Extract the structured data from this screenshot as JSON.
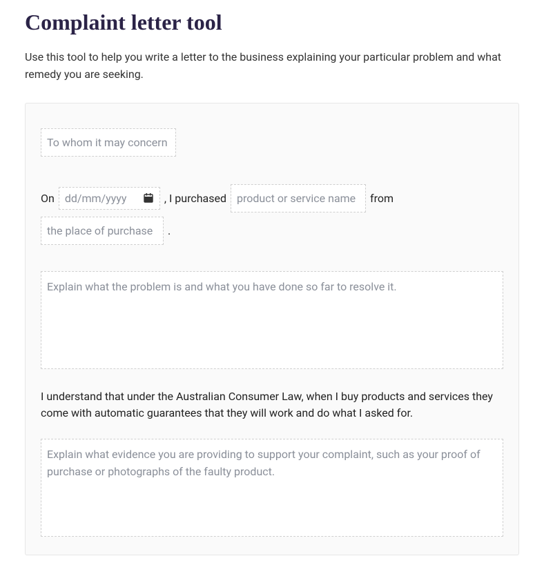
{
  "title": "Complaint letter tool",
  "intro": "Use this tool to help you write a letter to the business explaining your particular problem and what remedy you are seeking.",
  "form": {
    "salutation_placeholder": "To whom it may concern",
    "sentence": {
      "on": "On",
      "date_placeholder": "dd/mm/yyyy",
      "i_purchased": ", I purchased",
      "product_placeholder": "product or service name",
      "from": "from",
      "place_placeholder": "the place of purchase",
      "period": "."
    },
    "problem_placeholder": "Explain what the problem is and what you have done so far to resolve it.",
    "acl_text": "I understand that under the Australian Consumer Law, when I buy products and services they come with automatic guarantees that they will work and do what I asked for.",
    "evidence_placeholder": "Explain what evidence you are providing to support your complaint, such as your proof of purchase or photographs of the faulty product."
  }
}
